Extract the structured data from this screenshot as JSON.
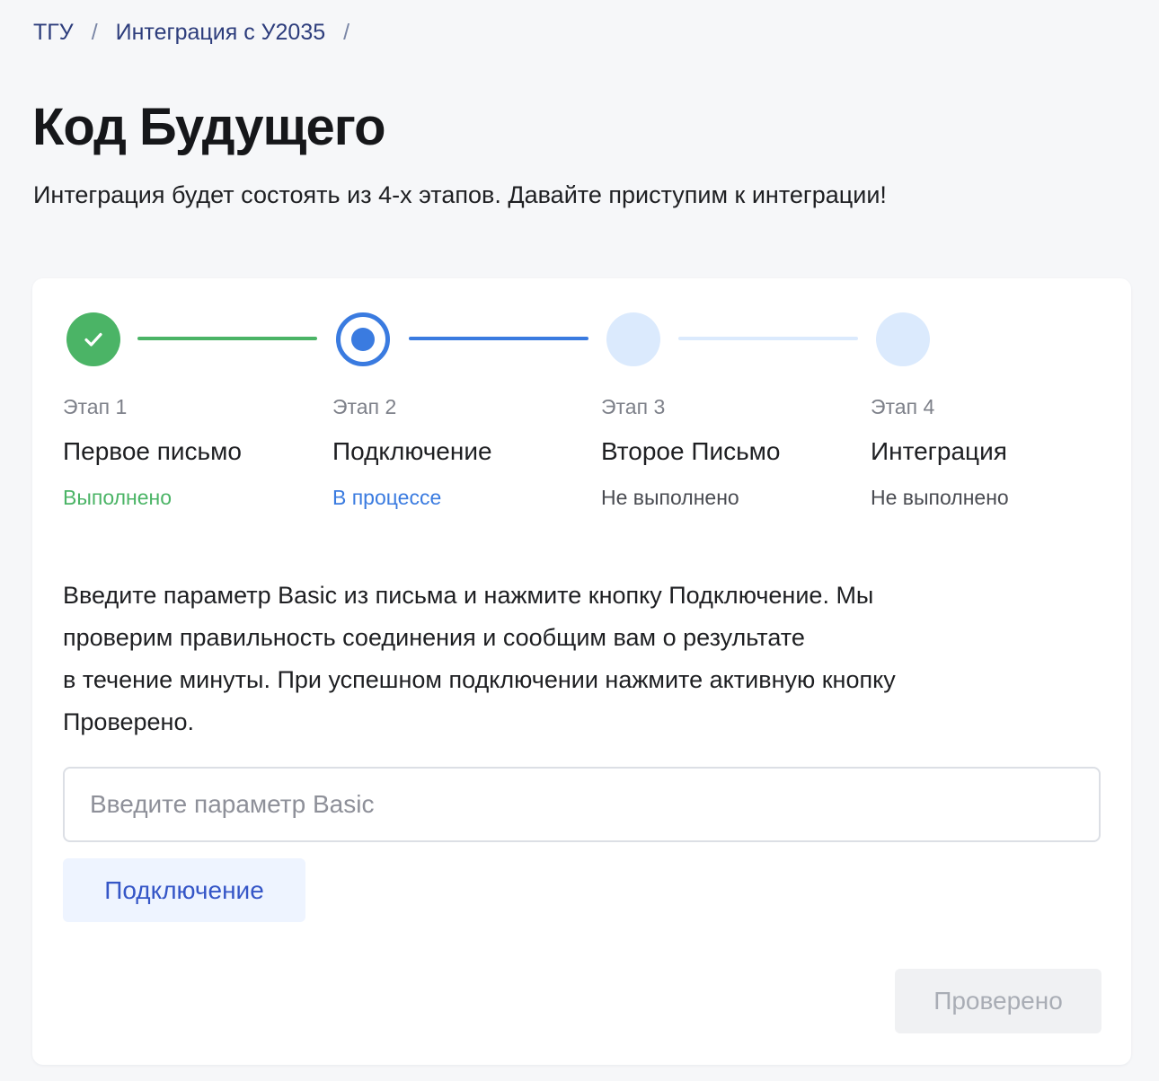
{
  "breadcrumb": {
    "items": [
      "ТГУ",
      "Интеграция с У2035"
    ],
    "separator": "/"
  },
  "page": {
    "title": "Код Будущего",
    "subtitle": "Интеграция будет состоять из  4-х этапов. Давайте приступим к интеграции!"
  },
  "steps": [
    {
      "num": "Этап 1",
      "name": "Первое письмо",
      "status": "Выполнено",
      "state": "done"
    },
    {
      "num": "Этап 2",
      "name": "Подключение",
      "status": "В процессе",
      "state": "active"
    },
    {
      "num": "Этап 3",
      "name": "Второе Письмо",
      "status": "Не выполнено",
      "state": "pending"
    },
    {
      "num": "Этап 4",
      "name": "Интеграция",
      "status": "Не выполнено",
      "state": "pending"
    }
  ],
  "instructions": [
    "Введите параметр Basic из письма и нажмите кнопку Подключение. Мы",
    "проверим правильность соединения и сообщим вам о результате",
    "в течение минуты. При успешном подключении нажмите активную кнопку",
    "Проверено."
  ],
  "form": {
    "input_value": "",
    "input_placeholder": "Введите параметр Basic",
    "connect_label": "Подключение",
    "verified_label": "Проверено"
  },
  "colors": {
    "done": "#4bb466",
    "active": "#3a7be0",
    "pending": "#dbeafd",
    "link": "#2d3d7c"
  },
  "icons": {
    "done_step": "check-icon",
    "active_step": "radio-dot-icon"
  }
}
